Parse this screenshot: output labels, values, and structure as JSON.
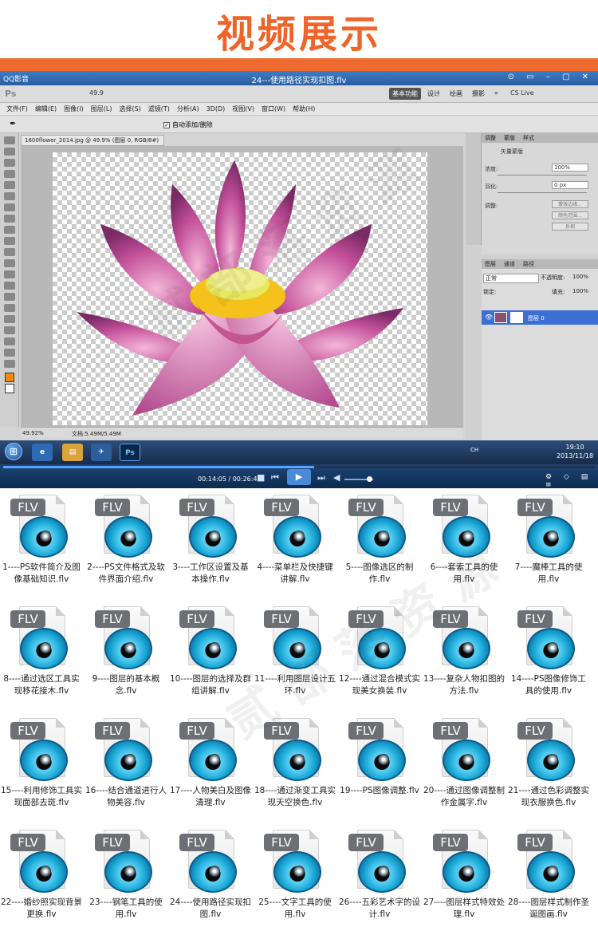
{
  "banner": {
    "title": "视频展示"
  },
  "player": {
    "app_name": "QQ影音",
    "file_title": "24---使用路径实现扣图.flv",
    "time": "00:14:05 / 00:26:46",
    "progress": 0.526
  },
  "photoshop": {
    "logo": "Ps",
    "zoom_top": "49.9",
    "workspace": [
      "基本功能",
      "设计",
      "绘画",
      "摄影",
      "»"
    ],
    "cslive": "CS Live",
    "menu": [
      "文件(F)",
      "编辑(E)",
      "图像(I)",
      "图层(L)",
      "选择(S)",
      "滤镜(T)",
      "分析(A)",
      "3D(D)",
      "视图(V)",
      "窗口(W)",
      "帮助(H)"
    ],
    "auto_add_delete": "自动添加/删除",
    "doc_tab": "1600flower_2014.jpg @ 49.9% (图层 0, RGB/8#)",
    "status_zoom": "49.92%",
    "status_doc": "文档:5.49M/5.49M",
    "panel_tabs": [
      "调整",
      "蒙版",
      "样式"
    ],
    "mask": {
      "label": "矢量蒙版",
      "density_label": "浓度:",
      "density_value": "100%",
      "feather_label": "羽化:",
      "feather_value": "0 px",
      "refine_label": "调整:",
      "edge_btn": "蒙版边缘...",
      "color_btn": "颜色范围...",
      "invert_btn": "反相"
    },
    "layers": {
      "tabs": [
        "图层",
        "通道",
        "路径"
      ],
      "blend_mode": "正常",
      "opacity_label": "不透明度:",
      "opacity_value": "100%",
      "lock_label": "锁定:",
      "fill_label": "填充:",
      "fill_value": "100%",
      "layer_name": "图层 0"
    }
  },
  "taskbar": {
    "ps_label": "Ps",
    "tray": "CH",
    "time": "19:10",
    "date": "2013/11/18"
  },
  "files": [
    "1----PS软件简介及图像基础知识.flv",
    "2----PS文件格式及软件界面介绍.flv",
    "3----工作区设置及基本操作.flv",
    "4----菜单栏及快捷键讲解.flv",
    "5----图像选区的制作.flv",
    "6----套索工具的使用.flv",
    "7----魔棒工具的使用.flv",
    "8----通过选区工具实现移花接木.flv",
    "9----图层的基本概念.flv",
    "10----图层的选择及群组讲解.flv",
    "11----利用图层设计五环.flv",
    "12----通过混合模式实现美女换装.flv",
    "13----复杂人物扣图的方法.flv",
    "14----PS图像修饰工具的使用.flv",
    "15----利用修饰工具实现面部去斑.flv",
    "16----结合通道进行人物美容.flv",
    "17----人物美白及图像清理.flv",
    "18----通过渐变工具实现天空换色.flv",
    "19----PS图像调整.flv",
    "20----通过图像调整制作金属字.flv",
    "21----通过色彩调整实现衣服换色.flv",
    "22----婚纱照实现背景更换.flv",
    "23----钢笔工具的使用.flv",
    "24----使用路径实现扣图.flv",
    "25----文字工具的使用.flv",
    "26----五彩艺术字的设计.flv",
    "27----图层样式特效处理.flv",
    "28----图层样式制作圣诞图画.flv"
  ],
  "file_badge": "FLV"
}
